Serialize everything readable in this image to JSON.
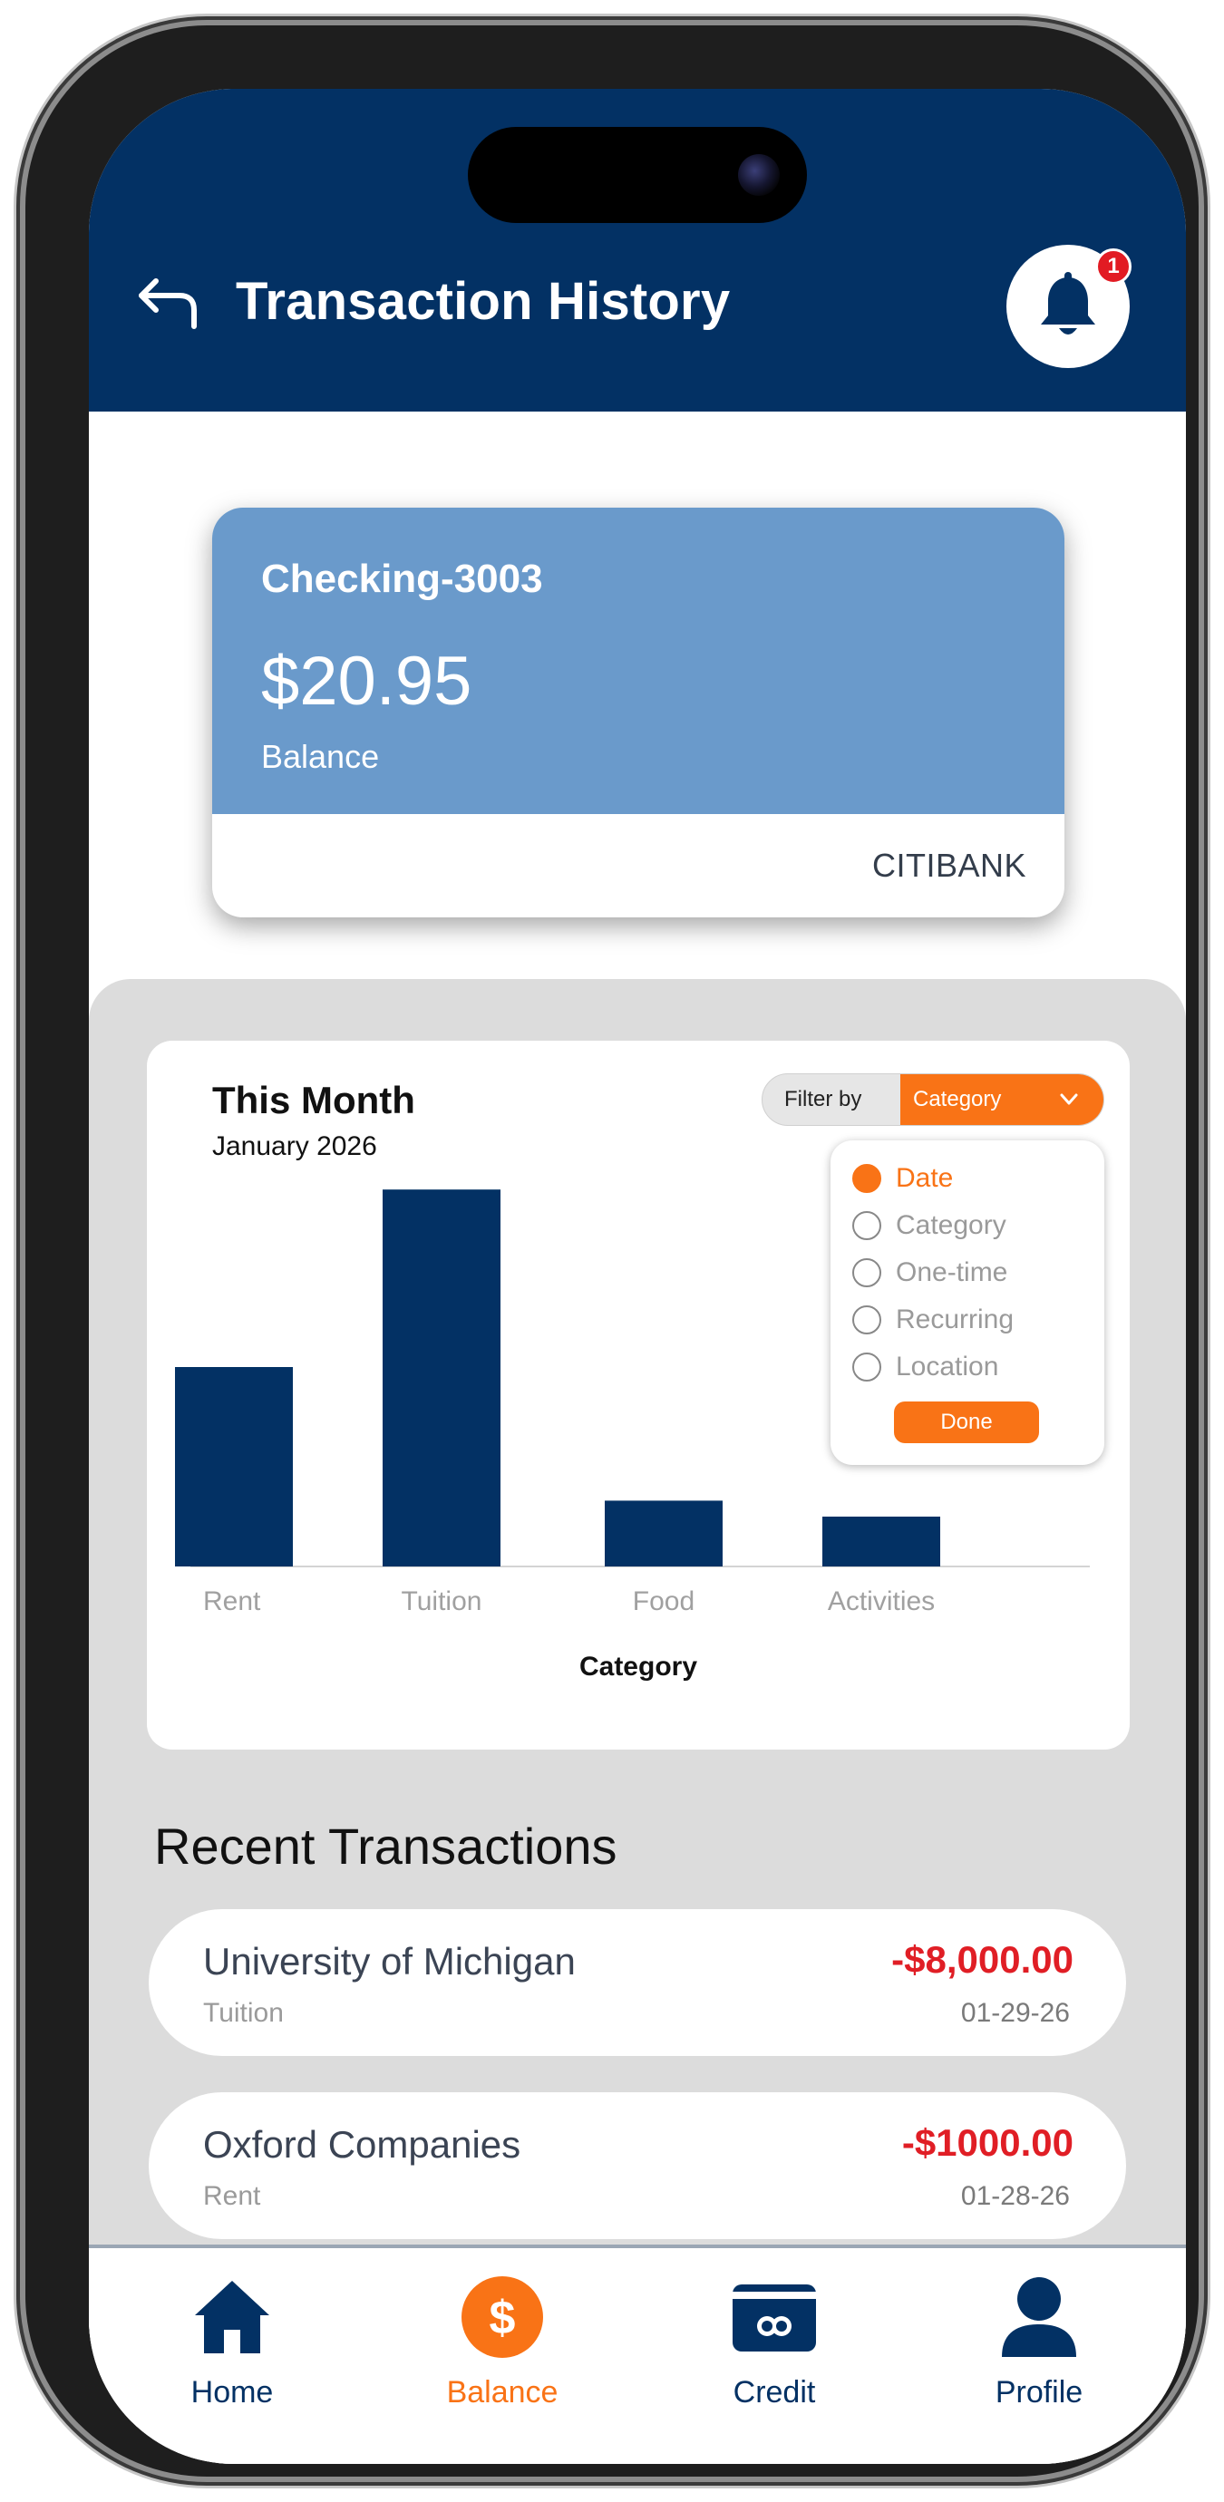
{
  "header": {
    "title": "Transaction History",
    "notification_count": "1"
  },
  "account": {
    "name": "Checking-3003",
    "balance": "$20.95",
    "balance_label": "Balance",
    "bank": "CITIBANK"
  },
  "chart": {
    "title": "This Month",
    "subtitle": "January 2026",
    "filter_label": "Filter by",
    "filter_value": "Category",
    "filter_options": [
      {
        "label": "Date",
        "selected": true
      },
      {
        "label": "Category",
        "selected": false
      },
      {
        "label": "One-time",
        "selected": false
      },
      {
        "label": "Recurring",
        "selected": false
      },
      {
        "label": "Location",
        "selected": false
      }
    ],
    "done_label": "Done"
  },
  "chart_data": {
    "type": "bar",
    "categories": [
      "Rent",
      "Tuition",
      "Food",
      "Activities"
    ],
    "values": [
      1000,
      1890,
      330,
      250
    ],
    "xlabel": "Category",
    "ylabel": "",
    "ylim": [
      0,
      2000
    ],
    "color": "#033164",
    "grid": false
  },
  "transactions": {
    "title": "Recent Transactions",
    "items": [
      {
        "merchant": "University of Michigan",
        "category": "Tuition",
        "amount": "-$8,000.00",
        "date": "01-29-26"
      },
      {
        "merchant": "Oxford Companies",
        "category": "Rent",
        "amount": "-$1000.00",
        "date": "01-28-26"
      }
    ]
  },
  "nav": {
    "items": [
      {
        "label": "Home",
        "icon": "home-icon",
        "active": false
      },
      {
        "label": "Balance",
        "icon": "dollar-icon",
        "active": true
      },
      {
        "label": "Credit",
        "icon": "credit-card-icon",
        "active": false
      },
      {
        "label": "Profile",
        "icon": "profile-icon",
        "active": false
      }
    ]
  },
  "colors": {
    "navy": "#033164",
    "accent": "#f97316",
    "card_blue": "#6a9acb",
    "negative": "#e01e25"
  }
}
